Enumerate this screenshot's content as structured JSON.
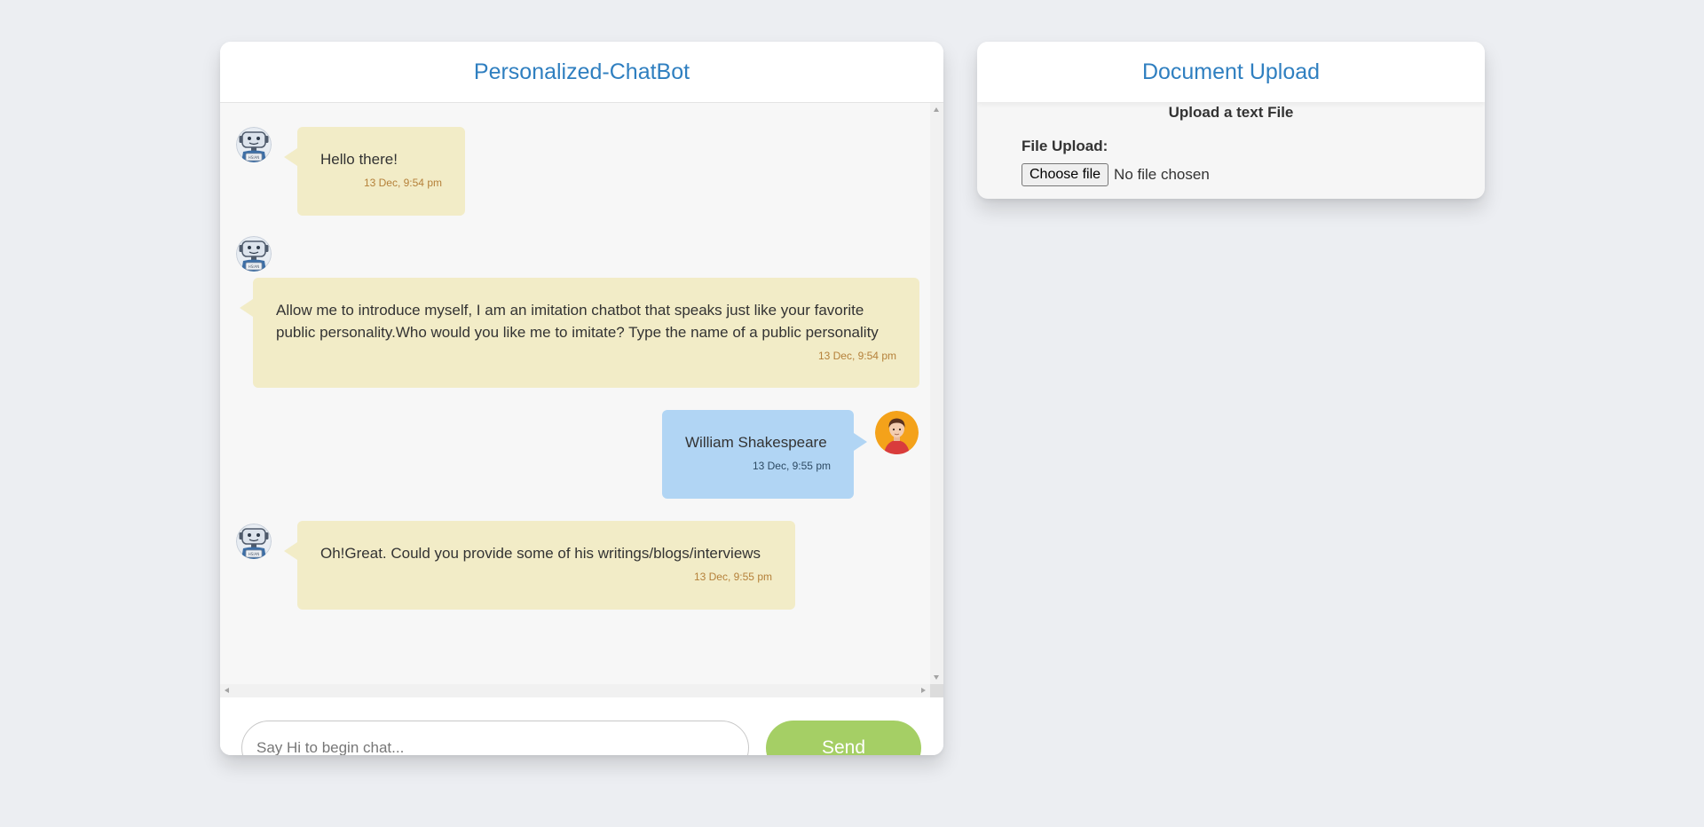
{
  "chat": {
    "title": "Personalized-ChatBot",
    "messages": [
      {
        "sender": "bot",
        "text": "Hello there!",
        "time": "13 Dec, 9:54 pm"
      },
      {
        "sender": "bot",
        "text": "Allow me to introduce myself, I am an imitation chatbot that speaks just like your favorite public personality.Who would you like me to imitate? Type the name of a public personality",
        "time": "13 Dec, 9:54 pm"
      },
      {
        "sender": "user",
        "text": "William Shakespeare",
        "time": "13 Dec, 9:55 pm"
      },
      {
        "sender": "bot",
        "text": "Oh!Great. Could you provide some of his writings/blogs/interviews",
        "time": "13 Dec, 9:55 pm"
      }
    ],
    "input": {
      "placeholder": "Say Hi to begin chat...",
      "value": ""
    },
    "send_label": "Send",
    "bot_avatar_icon": "robot-avatar-icon",
    "user_avatar_icon": "user-avatar-icon"
  },
  "upload": {
    "title": "Document Upload",
    "subtitle": "Upload a text File",
    "field_label": "File Upload:",
    "choose_label": "Choose file",
    "status": "No file chosen"
  },
  "colors": {
    "page_bg": "#eceef2",
    "header_text": "#2f7fc0",
    "bot_bubble": "#f2ecc7",
    "user_bubble": "#b1d5f4",
    "bot_time": "#b5813a",
    "send_button": "#a5cf65"
  }
}
